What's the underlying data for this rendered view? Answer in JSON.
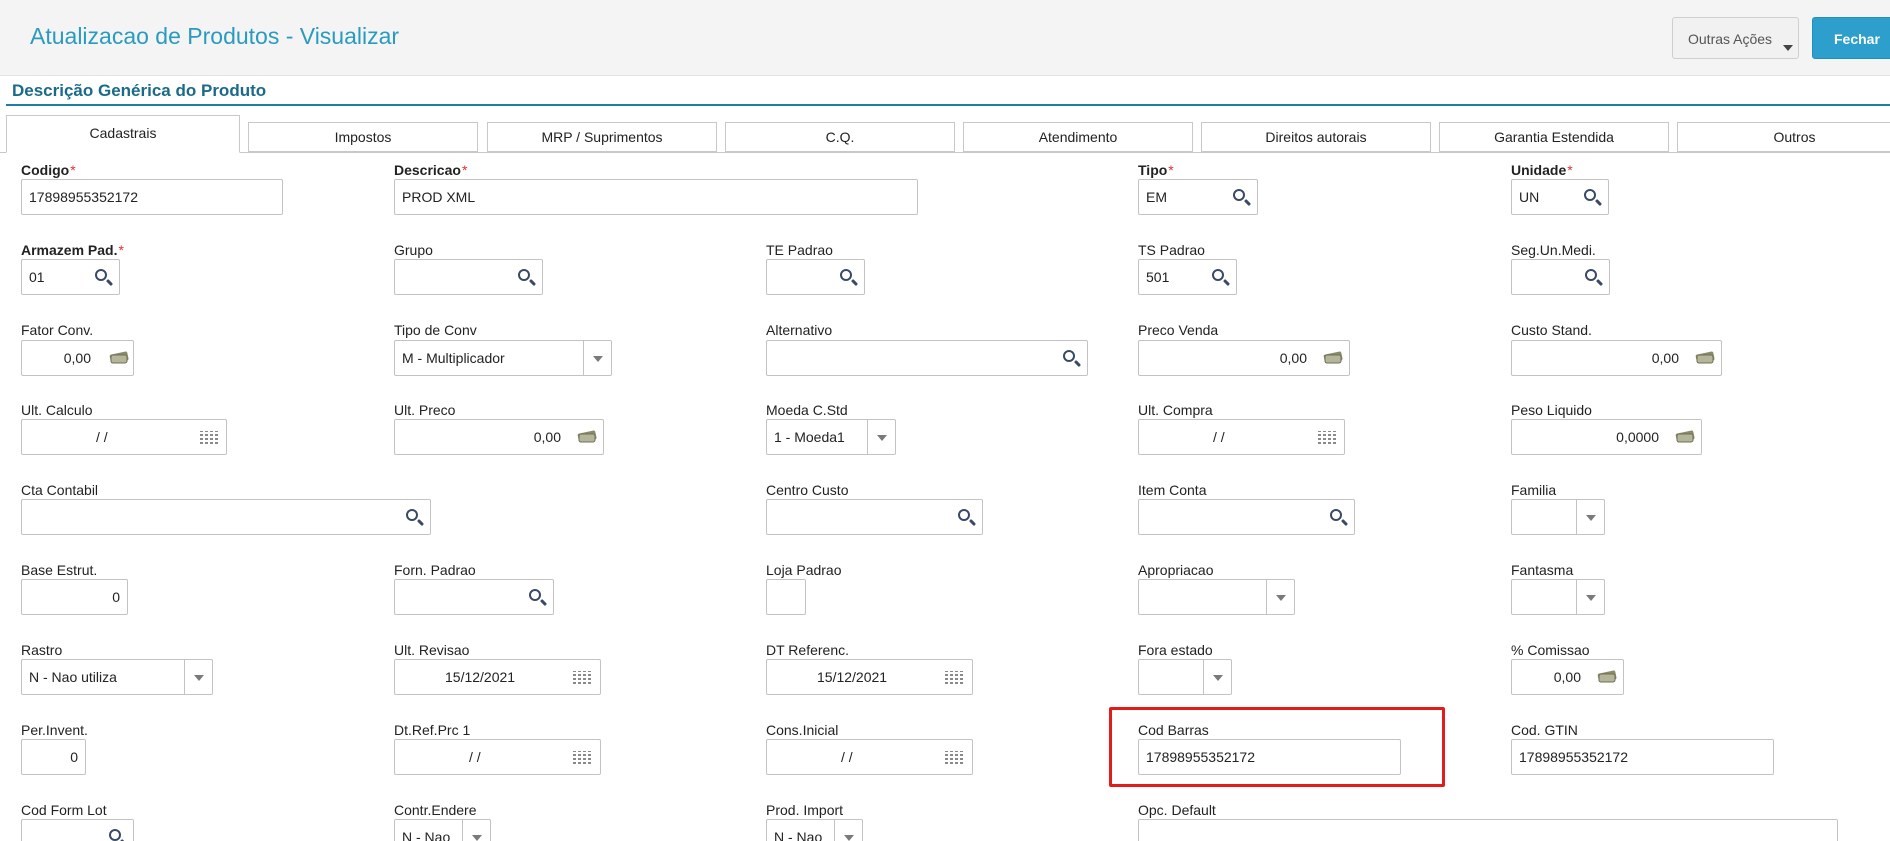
{
  "header": {
    "title": "Atualizacao de Produtos - Visualizar",
    "outras_acoes": "Outras Ações",
    "fechar": "Fechar"
  },
  "section": {
    "title": "Descrição Genérica do Produto"
  },
  "tabs": [
    "Cadastrais",
    "Impostos",
    "MRP / Suprimentos",
    "C.Q.",
    "Atendimento",
    "Direitos autorais",
    "Garantia Estendida",
    "Outros"
  ],
  "fields": {
    "codigo": {
      "label": "Codigo",
      "value": "17898955352172"
    },
    "descricao": {
      "label": "Descricao",
      "value": "PROD XML"
    },
    "tipo": {
      "label": "Tipo",
      "value": "EM"
    },
    "unidade": {
      "label": "Unidade",
      "value": "UN"
    },
    "armazem": {
      "label": "Armazem Pad.",
      "value": "01"
    },
    "grupo": {
      "label": "Grupo",
      "value": ""
    },
    "te_padrao": {
      "label": "TE Padrao",
      "value": ""
    },
    "ts_padrao": {
      "label": "TS Padrao",
      "value": "501"
    },
    "seg_un": {
      "label": "Seg.Un.Medi.",
      "value": ""
    },
    "fator_conv": {
      "label": "Fator Conv.",
      "value": "0,00"
    },
    "tipo_conv": {
      "label": "Tipo de Conv",
      "value": "M - Multiplicador"
    },
    "alternativo": {
      "label": "Alternativo",
      "value": ""
    },
    "preco_venda": {
      "label": "Preco Venda",
      "value": "0,00"
    },
    "custo_stand": {
      "label": "Custo Stand.",
      "value": "0,00"
    },
    "ult_calculo": {
      "label": "Ult. Calculo",
      "value": "/ /"
    },
    "ult_preco": {
      "label": "Ult. Preco",
      "value": "0,00"
    },
    "moeda_cstd": {
      "label": "Moeda C.Std",
      "value": "1 - Moeda1"
    },
    "ult_compra": {
      "label": "Ult. Compra",
      "value": "/ /"
    },
    "peso_liquido": {
      "label": "Peso Liquido",
      "value": "0,0000"
    },
    "cta_contabil": {
      "label": "Cta Contabil",
      "value": ""
    },
    "centro_custo": {
      "label": "Centro Custo",
      "value": ""
    },
    "item_conta": {
      "label": "Item Conta",
      "value": ""
    },
    "familia": {
      "label": "Familia",
      "value": ""
    },
    "base_estrut": {
      "label": "Base Estrut.",
      "value": "0"
    },
    "forn_padrao": {
      "label": "Forn. Padrao",
      "value": ""
    },
    "loja_padrao": {
      "label": "Loja Padrao",
      "value": ""
    },
    "apropriacao": {
      "label": "Apropriacao",
      "value": ""
    },
    "fantasma": {
      "label": "Fantasma",
      "value": ""
    },
    "rastro": {
      "label": "Rastro",
      "value": "N - Nao utiliza"
    },
    "ult_revisao": {
      "label": "Ult. Revisao",
      "value": "15/12/2021"
    },
    "dt_referenc": {
      "label": "DT Referenc.",
      "value": "15/12/2021"
    },
    "fora_estado": {
      "label": "Fora estado",
      "value": ""
    },
    "comissao": {
      "label": "% Comissao",
      "value": "0,00"
    },
    "per_invent": {
      "label": "Per.Invent.",
      "value": "0"
    },
    "dt_ref_prc": {
      "label": "Dt.Ref.Prc 1",
      "value": "/ /"
    },
    "cons_inicial": {
      "label": "Cons.Inicial",
      "value": "/ /"
    },
    "cod_barras": {
      "label": "Cod Barras",
      "value": "17898955352172"
    },
    "cod_gtin": {
      "label": "Cod. GTIN",
      "value": "17898955352172"
    },
    "cod_form_lot": {
      "label": "Cod Form Lot",
      "value": ""
    },
    "contr_endere": {
      "label": "Contr.Endere",
      "value": "N - Nao"
    },
    "prod_import": {
      "label": "Prod. Import",
      "value": "N - Nao"
    },
    "opc_default": {
      "label": "Opc. Default",
      "value": ""
    }
  }
}
